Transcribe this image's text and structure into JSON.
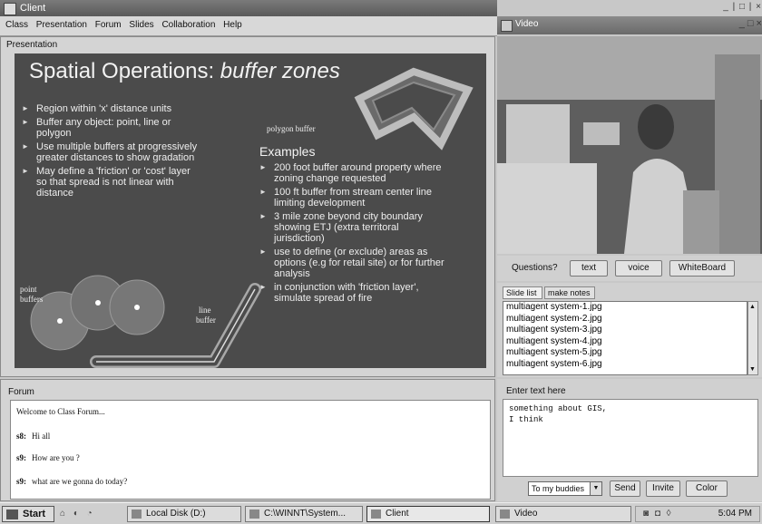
{
  "window": {
    "title": "Client",
    "controls": "_ | □ | ×"
  },
  "menu": [
    "Class",
    "Presentation",
    "Forum",
    "Slides",
    "Collaboration",
    "Help"
  ],
  "presentation": {
    "label": "Presentation",
    "slide": {
      "title_plain": "Spatial Operations: ",
      "title_italic": "buffer zones",
      "left_bullets": [
        "Region within 'x' distance units",
        "Buffer any object: point, line or polygon",
        "Use multiple buffers at progressively greater distances to show gradation",
        "May  define a 'friction' or 'cost' layer so that spread is not linear with distance"
      ],
      "examples_heading": "Examples",
      "right_bullets": [
        "200 foot buffer around property where zoning change requested",
        "100 ft buffer from stream center line limiting development",
        "3 mile zone beyond city boundary showing ETJ (extra territoral jurisdiction)",
        "use to define (or exclude) areas as options  (e.g for retail site) or for further analysis",
        "in conjunction with 'friction layer', simulate spread of fire"
      ],
      "fig_polygon": "polygon buffer",
      "fig_point_1": "point",
      "fig_point_2": "buffers",
      "fig_line_1": "line",
      "fig_line_2": "buffer"
    }
  },
  "video": {
    "title": "Video",
    "controls": "_ □ ×"
  },
  "questions": {
    "label": "Questions?",
    "buttons": [
      "text",
      "voice",
      "WhiteBoard"
    ]
  },
  "slides_panel": {
    "tabs": [
      "Slide list",
      "make notes"
    ],
    "items": [
      "multiagent system-1.jpg",
      "multiagent system-2.jpg",
      "multiagent system-3.jpg",
      "multiagent system-4.jpg",
      "multiagent system-5.jpg",
      "multiagent system-6.jpg"
    ]
  },
  "forum": {
    "label": "Forum",
    "messages": [
      {
        "user": "",
        "text": "Welcome to Class Forum..."
      },
      {
        "user": "s8:",
        "text": "Hi all"
      },
      {
        "user": "s9:",
        "text": "How are you ?"
      },
      {
        "user": "s9:",
        "text": "what are we gonna do today?"
      }
    ]
  },
  "enter_text": {
    "label": "Enter text here",
    "value": "something about GIS,\nI think",
    "recipient": "To my buddies",
    "buttons": [
      "Send",
      "Invite",
      "Color"
    ]
  },
  "taskbar": {
    "start": "Start",
    "quick_launch": "⌂ ◐ ◔",
    "tasks": [
      "Local Disk (D:)",
      "C:\\WINNT\\System...",
      "Client",
      "Video"
    ],
    "tray_icons": "◙ ◘ ◊",
    "clock": "5:04 PM"
  },
  "colors": {
    "slide_bg": "#4b4b4b",
    "chrome": "#d0d0d0"
  }
}
